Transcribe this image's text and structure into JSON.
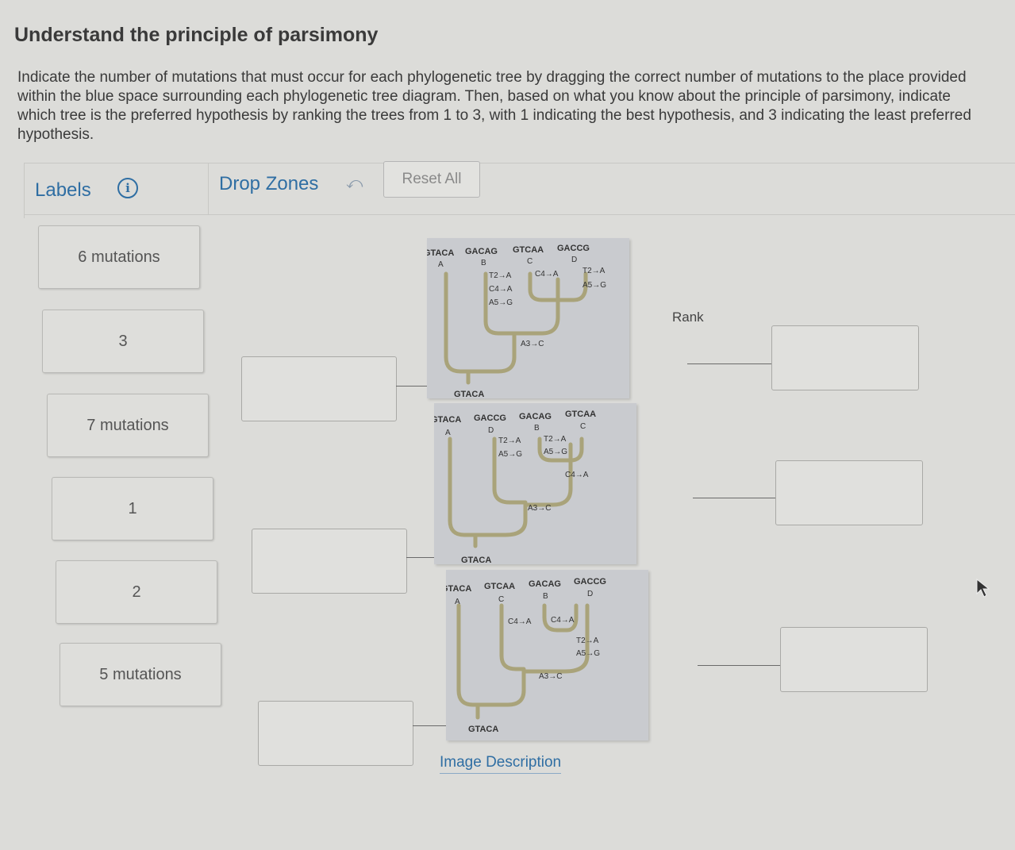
{
  "page": {
    "title": "Understand the principle of parsimony",
    "instructions": "Indicate the number of mutations that must occur for each phylogenetic tree by dragging the correct number of mutations to the place provided within the blue space surrounding each phylogenetic tree diagram. Then, based on what you know about the principle of parsimony, indicate which tree is the preferred hypothesis by ranking the trees from 1 to 3, with 1 indicating the best hypothesis, and 3 indicating the least preferred hypothesis."
  },
  "toolbar": {
    "labels_heading": "Labels",
    "info_icon": "info-icon",
    "info_glyph": "i",
    "drop_zones_heading": "Drop Zones",
    "undo_icon": "undo-icon",
    "undo_glyph": "⤺",
    "reset_label": "Reset All"
  },
  "labels": [
    {
      "text": "6 mutations"
    },
    {
      "text": "3"
    },
    {
      "text": "7 mutations"
    },
    {
      "text": "1"
    },
    {
      "text": "2"
    },
    {
      "text": "5 mutations"
    }
  ],
  "trees": [
    {
      "root": "GTACA",
      "tips": [
        {
          "seq": "GTACA",
          "id": "A"
        },
        {
          "seq": "GACAG",
          "id": "B"
        },
        {
          "seq": "GTCAA",
          "id": "C"
        },
        {
          "seq": "GACCG",
          "id": "D"
        }
      ],
      "mutations": [
        "T2→A",
        "C4→A",
        "A5→G",
        "C4→A",
        "T2→A",
        "A5→G",
        "A3→C"
      ]
    },
    {
      "root": "GTACA",
      "tips": [
        {
          "seq": "GTACA",
          "id": "A"
        },
        {
          "seq": "GACCG",
          "id": "D"
        },
        {
          "seq": "GACAG",
          "id": "B"
        },
        {
          "seq": "GTCAA",
          "id": "C"
        }
      ],
      "mutations": [
        "T2→A",
        "A5→G",
        "T2→A",
        "A5→G",
        "C4→A",
        "A3→C"
      ]
    },
    {
      "root": "GTACA",
      "tips": [
        {
          "seq": "GTACA",
          "id": "A"
        },
        {
          "seq": "GTCAA",
          "id": "C"
        },
        {
          "seq": "GACAG",
          "id": "B"
        },
        {
          "seq": "GACCG",
          "id": "D"
        }
      ],
      "mutations": [
        "C4→A",
        "C4→A",
        "T2→A",
        "A5→G",
        "A3→C"
      ]
    }
  ],
  "rank": {
    "label": "Rank"
  },
  "image_description": "Image Description",
  "colors": {
    "accent": "#2f6ea3",
    "branch": "#a9a37a",
    "panel": "#c9cbcf",
    "background": "#dcdcd9"
  }
}
